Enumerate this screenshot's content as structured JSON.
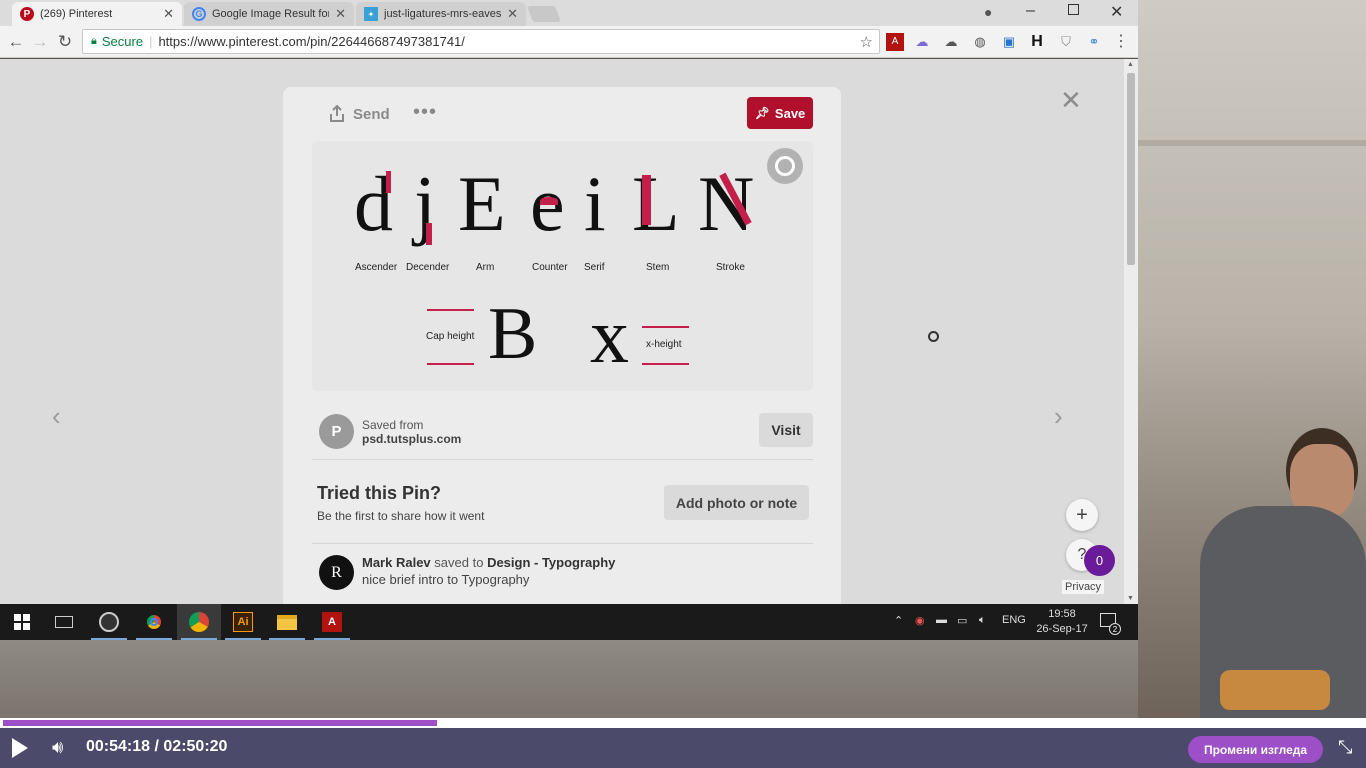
{
  "browser": {
    "tabs": [
      {
        "label": "(269) Pinterest",
        "icon": "pinterest-icon"
      },
      {
        "label": "Google Image Result for",
        "icon": "google-icon"
      },
      {
        "label": "just-ligatures-mrs-eaves",
        "icon": "image-file-icon"
      }
    ],
    "secure_label": "Secure",
    "url": "https://www.pinterest.com/pin/226446687497381741/"
  },
  "pin": {
    "send_label": "Send",
    "save_label": "Save",
    "image": {
      "glyphs": [
        "d",
        "j",
        "E",
        "e",
        "i",
        "L",
        "N",
        "B",
        "x"
      ],
      "labels": [
        "Ascender",
        "Decender",
        "Arm",
        "Counter",
        "Serif",
        "Stem",
        "Stroke",
        "Cap height",
        "x-height"
      ],
      "accent_color": "#c41e4a"
    },
    "saved_from_prefix": "Saved from",
    "source_domain": "psd.tutsplus.com",
    "avatar_letter": "P",
    "visit_label": "Visit",
    "tried_title": "Tried this Pin?",
    "tried_sub": "Be the first to share how it went",
    "add_photo_label": "Add photo or note",
    "comment": {
      "user": "Mark Ralev",
      "saved_to": "saved to",
      "board": "Design - Typography",
      "text": "nice brief intro to Typography",
      "avatar_letter": "R"
    }
  },
  "side": {
    "privacy_label": "Privacy",
    "notification_count": "0"
  },
  "taskbar": {
    "lang": "ENG",
    "time": "19:58",
    "date": "26-Sep-17",
    "notif_count": "2",
    "apps": [
      "windows-start",
      "task-view",
      "obs",
      "chrome",
      "chrome-active",
      "illustrator",
      "file-explorer",
      "acrobat"
    ]
  },
  "player": {
    "current_time": "00:54:18",
    "separator": "/",
    "total_time": "02:50:20",
    "progress": 0.318,
    "view_button": "Промени изгледа",
    "accent_color": "#9c4fc6"
  }
}
